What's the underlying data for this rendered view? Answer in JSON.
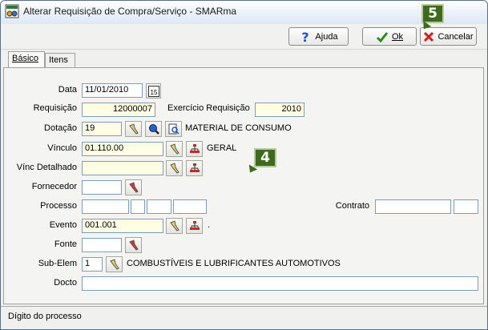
{
  "window": {
    "title": "Alterar Requisição de Compra/Serviço - SMARma"
  },
  "toolbar": {
    "help_label": "Ajuda",
    "ok_label": "Ok",
    "cancel_label": "Cancelar"
  },
  "tabs": [
    {
      "label": "Básico",
      "active": true
    },
    {
      "label": "Itens",
      "active": false
    }
  ],
  "form": {
    "data": {
      "label": "Data",
      "value": "11/01/2010",
      "calendar_text": "15"
    },
    "requisicao": {
      "label": "Requisição",
      "value": "12000007"
    },
    "exercicio": {
      "label": "Exercício Requisição",
      "value": "2010"
    },
    "dotacao": {
      "label": "Dotação",
      "value": "19",
      "description": "MATERIAL DE CONSUMO"
    },
    "vinculo": {
      "label": "Vínculo",
      "value": "01.110.00",
      "description": "GERAL"
    },
    "vinc_detalhado": {
      "label": "Vínc Detalhado",
      "value": ""
    },
    "fornecedor": {
      "label": "Fornecedor",
      "value": ""
    },
    "processo": {
      "label": "Processo",
      "values": [
        "",
        "",
        "",
        ""
      ]
    },
    "contrato": {
      "label": "Contrato",
      "values": [
        "",
        ""
      ]
    },
    "evento": {
      "label": "Evento",
      "value": "001.001",
      "description": "."
    },
    "fonte": {
      "label": "Fonte",
      "value": ""
    },
    "sub_elem": {
      "label": "Sub-Elem",
      "value": "1",
      "description": "COMBUSTÍVEIS E LUBRIFICANTES AUTOMOTIVOS"
    },
    "docto": {
      "label": "Docto",
      "value": ""
    }
  },
  "status": {
    "text": "Dígito do processo"
  },
  "annotations": {
    "badge_4": "4",
    "badge_5": "5"
  },
  "colors": {
    "required_field_bg": "#fffde4",
    "badge_bg": "#3d6a1c",
    "ok_check": "#2e8b22",
    "cancel_x": "#cc1f1f"
  }
}
